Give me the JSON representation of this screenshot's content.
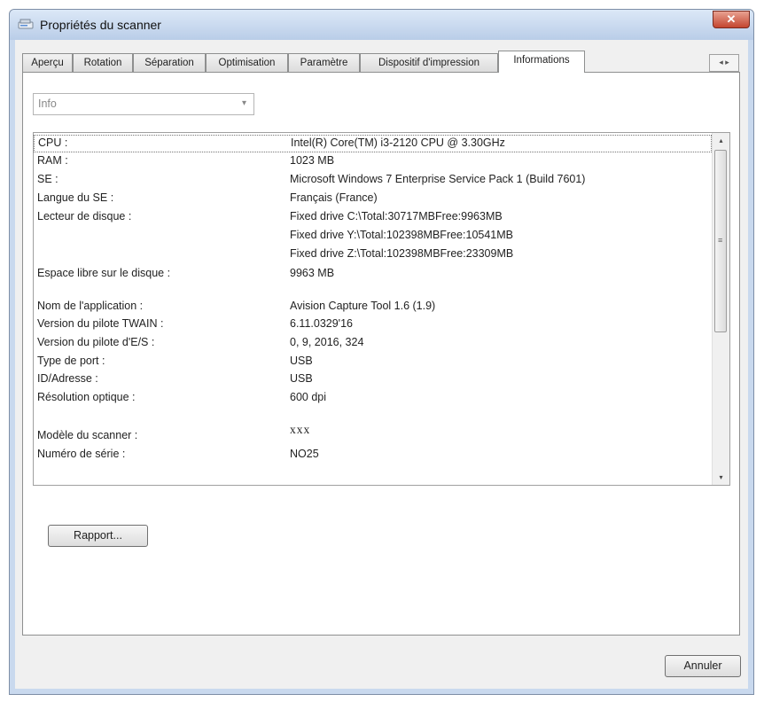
{
  "window": {
    "title": "Propriétés du scanner",
    "close_label": "✕"
  },
  "tabs": [
    {
      "label": "Aperçu"
    },
    {
      "label": "Rotation"
    },
    {
      "label": "Séparation"
    },
    {
      "label": "Optimisation"
    },
    {
      "label": "Paramètre"
    },
    {
      "label": "Dispositif d'impression"
    },
    {
      "label": "Informations",
      "active": true
    }
  ],
  "tab_scroll": {
    "left": "◂",
    "right": "▸"
  },
  "combo": {
    "value": "Info",
    "arrow": "▾"
  },
  "info_rows": [
    {
      "label": "CPU :",
      "value": "Intel(R) Core(TM) i3-2120 CPU @ 3.30GHz"
    },
    {
      "label": "RAM :",
      "value": "1023 MB"
    },
    {
      "label": "SE :",
      "value": "Microsoft Windows 7 Enterprise Service Pack 1 (Build 7601)"
    },
    {
      "label": "Langue du SE :",
      "value": "Français (France)"
    },
    {
      "label": "Lecteur de disque :",
      "value": "Fixed drive C:\\Total:30717MBFree:9963MB"
    },
    {
      "label": "",
      "value": "Fixed drive Y:\\Total:102398MBFree:10541MB"
    },
    {
      "label": "",
      "value": "Fixed drive Z:\\Total:102398MBFree:23309MB"
    },
    {
      "label": "Espace libre sur le disque :",
      "value": "9963 MB"
    },
    {
      "label": "Nom de l'application :",
      "value": "Avision Capture Tool 1.6 (1.9)"
    },
    {
      "label": "Version du pilote TWAIN :",
      "value": "6.11.0329'16"
    },
    {
      "label": "Version du pilote d'E/S :",
      "value": "0, 9, 2016, 324"
    },
    {
      "label": "Type de port :",
      "value": "USB"
    },
    {
      "label": "ID/Adresse :",
      "value": "USB"
    },
    {
      "label": "Résolution optique :",
      "value": "600 dpi"
    },
    {
      "label": "Modèle du scanner :",
      "value": "xxx"
    },
    {
      "label": "Numéro de série :",
      "value": "NO25"
    }
  ],
  "scrollbar": {
    "up": "▴",
    "down": "▾",
    "grip": "≡"
  },
  "buttons": {
    "report": "Rapport...",
    "cancel": "Annuler"
  }
}
